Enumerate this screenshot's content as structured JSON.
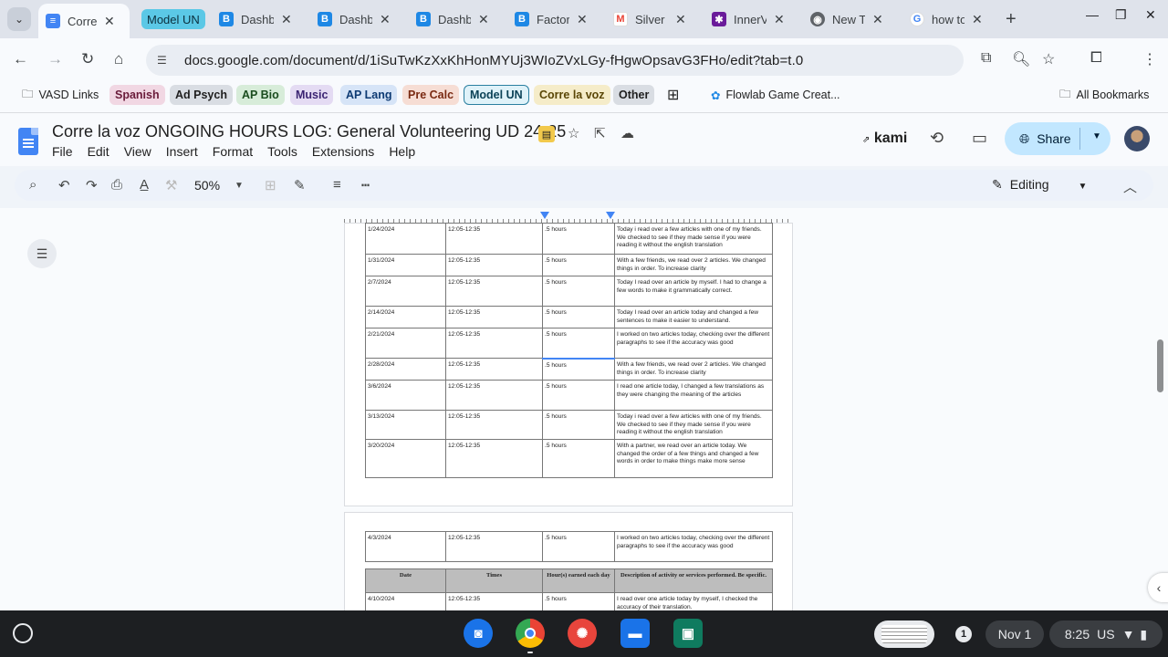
{
  "browser": {
    "tabs": [
      {
        "title": "Corre l",
        "favicon": "docs-icon",
        "color": "#4285f4",
        "active": true
      },
      {
        "title": "Dashb",
        "favicon": "b-icon",
        "color": "#1e88e5"
      },
      {
        "title": "Dashb",
        "favicon": "b-icon",
        "color": "#1e88e5"
      },
      {
        "title": "Dashb",
        "favicon": "b-icon",
        "color": "#1e88e5"
      },
      {
        "title": "Factor",
        "favicon": "b-icon",
        "color": "#1e88e5"
      },
      {
        "title": "Silver",
        "favicon": "gmail-icon",
        "color": "#ea4335"
      },
      {
        "title": "InnerV",
        "favicon": "innerv-icon",
        "color": "#6a1b9a"
      },
      {
        "title": "New T",
        "favicon": "chrome-icon",
        "color": "#5f6368"
      },
      {
        "title": "how to",
        "favicon": "google-icon",
        "color": "#4285f4"
      }
    ],
    "tab_group_label": "Model UN",
    "url": "docs.google.com/document/d/1iSuTwKzXxKhHonMYUj3WIoZVxLGy-fHgwOpsavG3FHo/edit?tab=t.0",
    "bookmarks": [
      {
        "label": "VASD Links",
        "type": "folder"
      },
      {
        "label": "Spanish",
        "bg": "#f1d7e3",
        "fg": "#6a1b3a"
      },
      {
        "label": "Ad Psych",
        "bg": "#d9dde3",
        "fg": "#202124"
      },
      {
        "label": "AP Bio",
        "bg": "#d7ecd9",
        "fg": "#1b4d1f"
      },
      {
        "label": "Music",
        "bg": "#e4dbf3",
        "fg": "#3b2473"
      },
      {
        "label": "AP Lang",
        "bg": "#d6e4f7",
        "fg": "#0d3a73"
      },
      {
        "label": "Pre Calc",
        "bg": "#f6ddd4",
        "fg": "#7a2a12"
      },
      {
        "label": "Model UN",
        "bg": "#dff2f9",
        "fg": "#0b4257"
      },
      {
        "label": "Corre la voz",
        "bg": "#f5ecc9",
        "fg": "#5a4606"
      },
      {
        "label": "Other",
        "bg": "#d9dde3",
        "fg": "#202124"
      },
      {
        "label": "Flowlab Game Creat...",
        "type": "link"
      },
      {
        "label": "All Bookmarks",
        "type": "folder"
      }
    ]
  },
  "doc": {
    "title": "Corre la voz  ONGOING HOURS LOG: General Volunteering UD 24-25",
    "menus": [
      "File",
      "Edit",
      "View",
      "Insert",
      "Format",
      "Tools",
      "Extensions",
      "Help"
    ],
    "kami_label": "kami",
    "share_label": "Share",
    "zoom": "50%",
    "mode": "Editing"
  },
  "table_page1": {
    "rows": [
      {
        "date": "1/24/2024",
        "time": "12:05-12:35",
        "hours": ".5 hours",
        "desc": " Today i read over a few articles with one of my friends. We checked to see if they made sense if you were reading it without the english translation"
      },
      {
        "date": "1/31/2024",
        "time": "12:05-12:35",
        "hours": ".5 hours",
        "desc": "With a few friends, we read over 2 articles. We changed things in order. To increase clarity"
      },
      {
        "date": "2/7/2024",
        "time": "12:05-12:35",
        "hours": ".5 hours",
        "desc": "Today I read over an article by myself. I had to change a few words to make it grammatically correct."
      },
      {
        "date": "2/14/2024",
        "time": "12:05-12:35",
        "hours": ".5 hours",
        "desc": "Today I read over an article today and changed a few sentences to make it easier to understand."
      },
      {
        "date": "2/21/2024",
        "time": "12:05-12:35",
        "hours": ".5 hours",
        "desc": "I worked on two articles today, checking over the different paragraphs to see if the accuracy was good"
      },
      {
        "date": "2/28/2024",
        "time": "12:05-12:35",
        "hours": ".5 hours",
        "desc": "With a few friends, we read over 2 articles. We changed things in order. To increase clarity"
      },
      {
        "date": "3/6/2024",
        "time": "12:05-12:35",
        "hours": ".5 hours",
        "desc": "I read one article today, I changed a few translations as they were changing the meaning of the articles"
      },
      {
        "date": "3/13/2024",
        "time": "12:05-12:35",
        "hours": ".5 hours",
        "desc": " Today i read over a few articles with one of my friends. We checked to see if they made sense if you were reading it without the english translation"
      },
      {
        "date": "3/20/2024",
        "time": "12:05-12:35",
        "hours": ".5 hours",
        "desc": "With a partner, we read over an article today. We changed the order of a few things and changed a few words in order to make things make more sense"
      }
    ]
  },
  "table_page2": {
    "row_top": {
      "date": "4/3/2024",
      "time": "12:05-12:35",
      "hours": ".5 hours",
      "desc": "I worked on two articles today, checking over the different paragraphs to see if the accuracy was good"
    },
    "headers": {
      "date": "Date",
      "time": "Times",
      "hours": "Hour(s) earned each day",
      "desc": "Description of activity or services performed. Be specific."
    },
    "row_after": {
      "date": "4/10/2024",
      "time": "12:05-12:35",
      "hours": ".5 hours",
      "desc": "I read over one article today by myself, I checked the accuracy of their translation."
    }
  },
  "shelf": {
    "notification_count": "1",
    "date": "Nov 1",
    "time": "8:25",
    "locale": "US"
  }
}
